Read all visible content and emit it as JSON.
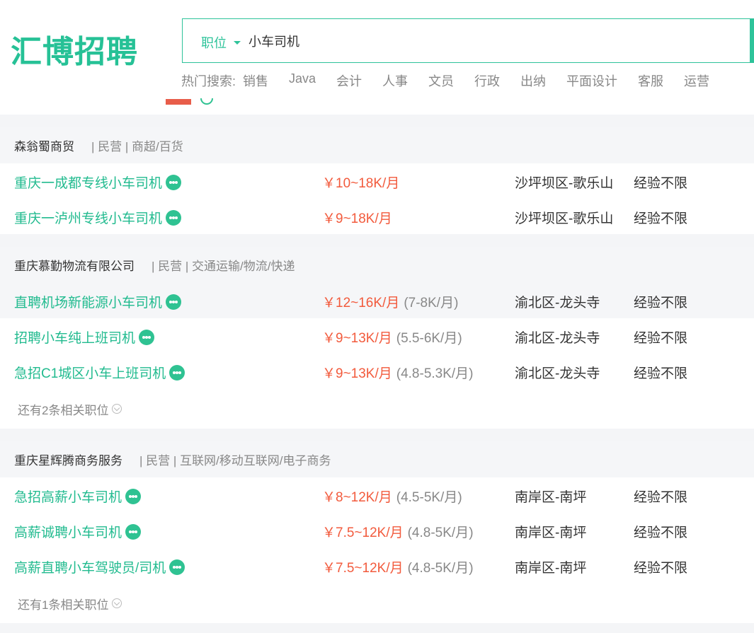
{
  "brand": {
    "logo_text": "汇博招聘",
    "accent": "#26c196"
  },
  "search": {
    "category": "职位",
    "query": "小车司机"
  },
  "hot_search": {
    "label": "热门搜索:",
    "items": [
      "销售",
      "Java",
      "会计",
      "人事",
      "文员",
      "行政",
      "出纳",
      "平面设计",
      "客服",
      "运营"
    ]
  },
  "colors": {
    "job_title": "#22bb8f",
    "salary": "#f25a3c"
  },
  "companies": [
    {
      "name": "森翁蜀商贸",
      "meta": "| 民营 | 商超/百货",
      "jobs": [
        {
          "title": "重庆一成都专线小车司机",
          "salary": "￥10~18K/月",
          "salary_extra": "",
          "location": "沙坪坝区-歌乐山",
          "experience": "经验不限"
        },
        {
          "title": "重庆一泸州专线小车司机",
          "salary": "￥9~18K/月",
          "salary_extra": "",
          "location": "沙坪坝区-歌乐山",
          "experience": "经验不限"
        }
      ],
      "more": ""
    },
    {
      "name": "重庆慕勤物流有限公司",
      "meta": "| 民营 | 交通运输/物流/快递",
      "jobs": [
        {
          "title": "直聘机场新能源小车司机",
          "salary": "￥12~16K/月",
          "salary_extra": "(7-8K/月)",
          "location": "渝北区-龙头寺",
          "experience": "经验不限"
        },
        {
          "title": "招聘小车纯上班司机",
          "salary": "￥9~13K/月",
          "salary_extra": "(5.5-6K/月)",
          "location": "渝北区-龙头寺",
          "experience": "经验不限"
        },
        {
          "title": "急招C1城区小车上班司机",
          "salary": "￥9~13K/月",
          "salary_extra": "(4.8-5.3K/月)",
          "location": "渝北区-龙头寺",
          "experience": "经验不限"
        }
      ],
      "more": "还有2条相关职位"
    },
    {
      "name": "重庆星辉腾商务服务",
      "meta": "| 民营 | 互联网/移动互联网/电子商务",
      "jobs": [
        {
          "title": "急招高薪小车司机",
          "salary": "￥8~12K/月",
          "salary_extra": "(4.5-5K/月)",
          "location": "南岸区-南坪",
          "experience": "经验不限"
        },
        {
          "title": "高薪诚聘小车司机",
          "salary": "￥7.5~12K/月",
          "salary_extra": "(4.8-5K/月)",
          "location": "南岸区-南坪",
          "experience": "经验不限"
        },
        {
          "title": "高薪直聘小车驾驶员/司机",
          "salary": "￥7.5~12K/月",
          "salary_extra": "(4.8-5K/月)",
          "location": "南岸区-南坪",
          "experience": "经验不限"
        }
      ],
      "more": "还有1条相关职位"
    }
  ]
}
